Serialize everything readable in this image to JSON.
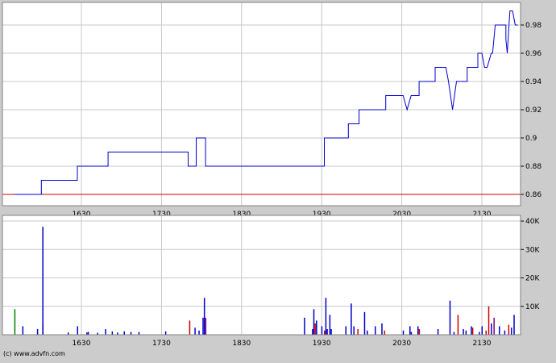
{
  "footer": {
    "copyright": "(c) www.advfn.com"
  },
  "colors": {
    "background": "#cccccc",
    "plot": "#ffffff",
    "grid": "#c8c8c8",
    "price_line": "#0000cc",
    "reference_line": "#cc0000",
    "volume_up": "#0000cc",
    "volume_down": "#cc0000",
    "volume_neutral": "#800080",
    "volume_start": "#008000"
  },
  "chart_data": [
    {
      "type": "line",
      "title": "",
      "x_range": [
        "15:40",
        "21:53"
      ],
      "ylim": [
        0.852,
        0.996
      ],
      "x_ticks": [
        "1630",
        "1730",
        "1830",
        "1930",
        "2030",
        "2130"
      ],
      "y_ticks": [
        "0.86",
        "0.88",
        "0.9",
        "0.92",
        "0.94",
        "0.96",
        "0.98"
      ],
      "y_tick_values": [
        0.86,
        0.88,
        0.9,
        0.92,
        0.94,
        0.96,
        0.98
      ],
      "grid": true,
      "reference_value": 0.86,
      "series": [
        {
          "points": [
            [
              "15:40",
              0.86
            ],
            [
              "16:00",
              0.86
            ],
            [
              "16:00",
              0.87
            ],
            [
              "16:27",
              0.87
            ],
            [
              "16:27",
              0.88
            ],
            [
              "16:50",
              0.88
            ],
            [
              "16:50",
              0.89
            ],
            [
              "17:50",
              0.89
            ],
            [
              "17:50",
              0.88
            ],
            [
              "17:56",
              0.88
            ],
            [
              "17:56",
              0.9
            ],
            [
              "18:03",
              0.9
            ],
            [
              "18:03",
              0.88
            ],
            [
              "19:32",
              0.88
            ],
            [
              "19:32",
              0.9
            ],
            [
              "19:50",
              0.9
            ],
            [
              "19:50",
              0.91
            ],
            [
              "19:58",
              0.91
            ],
            [
              "19:58",
              0.92
            ],
            [
              "20:18",
              0.92
            ],
            [
              "20:18",
              0.93
            ],
            [
              "20:31",
              0.93
            ],
            [
              "20:34",
              0.92
            ],
            [
              "20:37",
              0.93
            ],
            [
              "20:43",
              0.93
            ],
            [
              "20:43",
              0.94
            ],
            [
              "20:55",
              0.94
            ],
            [
              "20:55",
              0.95
            ],
            [
              "21:03",
              0.95
            ],
            [
              "21:05",
              0.94
            ],
            [
              "21:08",
              0.92
            ],
            [
              "21:11",
              0.94
            ],
            [
              "21:19",
              0.94
            ],
            [
              "21:19",
              0.95
            ],
            [
              "21:27",
              0.95
            ],
            [
              "21:27",
              0.96
            ],
            [
              "21:30",
              0.96
            ],
            [
              "21:32",
              0.95
            ],
            [
              "21:34",
              0.95
            ],
            [
              "21:37",
              0.96
            ],
            [
              "21:38",
              0.96
            ],
            [
              "21:40",
              0.98
            ],
            [
              "21:48",
              0.98
            ],
            [
              "21:48",
              0.97
            ],
            [
              "21:49",
              0.96
            ],
            [
              "21:51",
              0.99
            ],
            [
              "21:53",
              0.99
            ],
            [
              "21:55",
              0.98
            ],
            [
              "21:57",
              0.98
            ]
          ]
        }
      ]
    },
    {
      "type": "bar",
      "title": "",
      "ylim": [
        0,
        42000
      ],
      "x_ticks": [
        "1630",
        "1730",
        "1830",
        "1930",
        "2030",
        "2130"
      ],
      "y_ticks": [
        "10K",
        "20K",
        "30K",
        "40K"
      ],
      "y_tick_values": [
        10000,
        20000,
        30000,
        40000
      ],
      "grid": true,
      "bars": [
        [
          "15:40",
          9000,
          "start"
        ],
        [
          "15:46",
          3000,
          "up"
        ],
        [
          "15:57",
          2000,
          "up"
        ],
        [
          "16:01",
          4500,
          "up"
        ],
        [
          "16:01",
          38000,
          "up"
        ],
        [
          "16:20",
          800,
          "up"
        ],
        [
          "16:27",
          3000,
          "up"
        ],
        [
          "16:34",
          800,
          "up"
        ],
        [
          "16:35",
          1000,
          "up"
        ],
        [
          "16:42",
          700,
          "up"
        ],
        [
          "16:48",
          2000,
          "up"
        ],
        [
          "16:53",
          1200,
          "up"
        ],
        [
          "16:57",
          800,
          "up"
        ],
        [
          "17:02",
          1200,
          "up"
        ],
        [
          "17:07",
          1000,
          "up"
        ],
        [
          "17:13",
          1000,
          "up"
        ],
        [
          "17:33",
          1200,
          "up"
        ],
        [
          "17:51",
          5000,
          "down"
        ],
        [
          "17:55",
          2500,
          "up"
        ],
        [
          "17:58",
          1500,
          "up"
        ],
        [
          "18:01",
          6000,
          "up"
        ],
        [
          "18:02",
          13000,
          "up"
        ],
        [
          "18:03",
          6000,
          "neutral"
        ],
        [
          "19:17",
          6000,
          "up"
        ],
        [
          "19:23",
          2000,
          "up"
        ],
        [
          "19:24",
          9000,
          "up"
        ],
        [
          "19:25",
          4000,
          "down"
        ],
        [
          "19:26",
          5000,
          "up"
        ],
        [
          "19:30",
          3000,
          "up"
        ],
        [
          "19:32",
          1500,
          "down"
        ],
        [
          "19:33",
          13000,
          "up"
        ],
        [
          "19:34",
          2000,
          "up"
        ],
        [
          "19:36",
          7000,
          "up"
        ],
        [
          "19:37",
          2000,
          "up"
        ],
        [
          "19:48",
          3000,
          "up"
        ],
        [
          "19:52",
          11000,
          "up"
        ],
        [
          "19:54",
          3000,
          "up"
        ],
        [
          "19:57",
          2000,
          "down"
        ],
        [
          "20:02",
          8000,
          "up"
        ],
        [
          "20:04",
          1500,
          "up"
        ],
        [
          "20:10",
          3000,
          "up"
        ],
        [
          "20:15",
          4000,
          "up"
        ],
        [
          "20:17",
          1500,
          "down"
        ],
        [
          "20:31",
          1500,
          "up"
        ],
        [
          "20:36",
          3000,
          "up"
        ],
        [
          "20:37",
          1000,
          "up"
        ],
        [
          "20:42",
          3000,
          "up"
        ],
        [
          "20:43",
          2000,
          "down"
        ],
        [
          "20:57",
          2000,
          "up"
        ],
        [
          "21:06",
          12000,
          "up"
        ],
        [
          "21:09",
          1000,
          "up"
        ],
        [
          "21:12",
          7000,
          "down"
        ],
        [
          "21:16",
          2000,
          "up"
        ],
        [
          "21:18",
          1500,
          "up"
        ],
        [
          "21:22",
          3000,
          "up"
        ],
        [
          "21:23",
          2500,
          "down"
        ],
        [
          "21:28",
          1000,
          "up"
        ],
        [
          "21:30",
          3000,
          "up"
        ],
        [
          "21:33",
          1500,
          "down"
        ],
        [
          "21:35",
          10000,
          "down"
        ],
        [
          "21:37",
          4000,
          "up"
        ],
        [
          "21:39",
          6000,
          "neutral"
        ],
        [
          "21:43",
          3000,
          "up"
        ],
        [
          "21:47",
          1500,
          "up"
        ],
        [
          "21:50",
          3500,
          "down"
        ],
        [
          "21:52",
          2500,
          "up"
        ],
        [
          "21:54",
          7000,
          "up"
        ]
      ]
    }
  ]
}
